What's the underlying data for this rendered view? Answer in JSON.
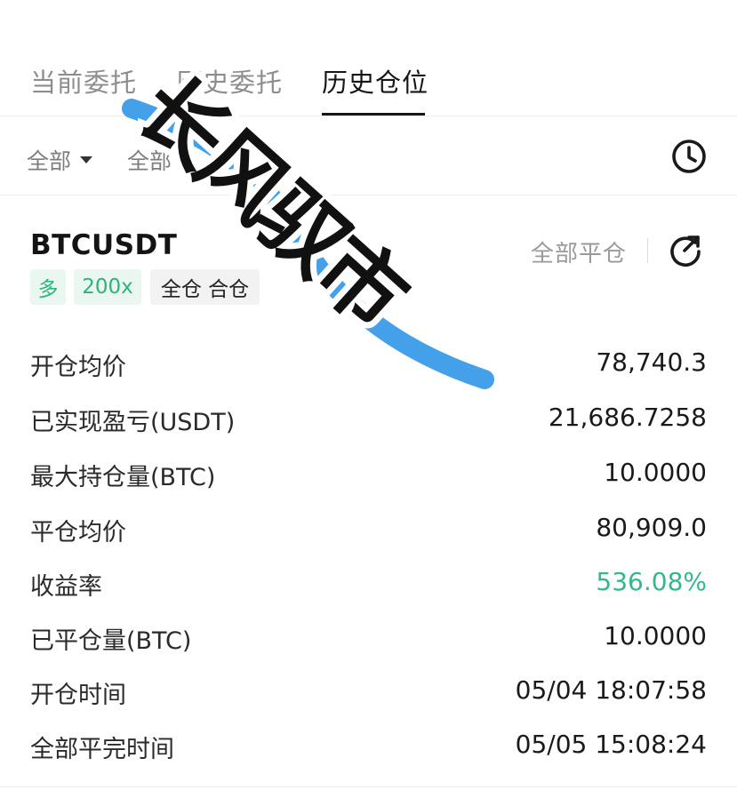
{
  "tabs": [
    {
      "label": "当前委托"
    },
    {
      "label": "历史委托"
    },
    {
      "label": "历史仓位"
    }
  ],
  "filters": [
    {
      "label": "全部"
    },
    {
      "label": "全部"
    }
  ],
  "position": {
    "symbol": "BTCUSDT",
    "close_all_label": "全部平仓",
    "badges": {
      "side": "多",
      "leverage": "200x",
      "margin": "全仓 合仓"
    },
    "rows": [
      {
        "label": "开仓均价",
        "value": "78,740.3"
      },
      {
        "label": "已实现盈亏(USDT)",
        "value": "21,686.7258"
      },
      {
        "label": "最大持仓量(BTC)",
        "value": "10.0000"
      },
      {
        "label": "平仓均价",
        "value": "80,909.0"
      },
      {
        "label": "收益率",
        "value": "536.08%"
      },
      {
        "label": "已平仓量(BTC)",
        "value": "10.0000"
      },
      {
        "label": "开仓时间",
        "value": "05/04 18:07:58"
      },
      {
        "label": "全部平完时间",
        "value": "05/05 15:08:24"
      }
    ]
  },
  "watermark_text": "长风驭市",
  "colors": {
    "positive": "#35b887",
    "badge_green_bg": "#e9f7f0",
    "watermark_stroke": "#3a9be8"
  }
}
